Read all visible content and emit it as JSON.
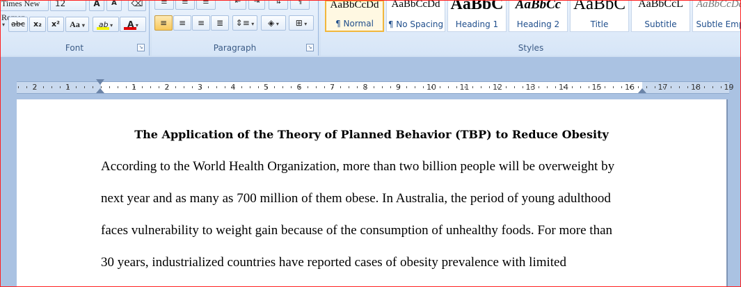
{
  "font_group": {
    "font_name": "Times New Roman",
    "font_size": "12",
    "label": "Font",
    "buttons": {
      "strikethrough": "abc",
      "subscript": "x₂",
      "superscript": "x²",
      "change_case": "Aa",
      "grow": "A",
      "shrink": "A",
      "font_color": "A",
      "highlight": "ab"
    }
  },
  "paragraph_group": {
    "label": "Paragraph"
  },
  "styles_group": {
    "label": "Styles",
    "items": [
      {
        "preview": "AaBbCcDd",
        "name": "¶ Normal"
      },
      {
        "preview": "AaBbCcDd",
        "name": "¶ No Spacing"
      },
      {
        "preview": "AaBbC",
        "name": "Heading 1"
      },
      {
        "preview": "AaBbCc",
        "name": "Heading 2"
      },
      {
        "preview": "AaBbC",
        "name": "Title"
      },
      {
        "preview": "AaBbCcL",
        "name": "Subtitle"
      },
      {
        "preview": "AaBbCcDd",
        "name": "Subtle Emp"
      }
    ]
  },
  "ruler": {
    "numbers": [
      "2",
      "1",
      "1",
      "2",
      "3",
      "4",
      "5",
      "6",
      "7",
      "8",
      "9",
      "10",
      "11",
      "12",
      "13",
      "14",
      "15",
      "16",
      "17",
      "18",
      "19"
    ]
  },
  "document": {
    "title": "The Application  of the Theory of Planned Behavior (TBP) to Reduce Obesity",
    "lines": [
      "According to the World Health Organization, more than two billion people will be overweight by",
      "next year and as many  as 700 million of them obese. In Australia, the period of young adulthood",
      "faces vulnerability to weight gain because of the consumption of unhealthy foods. For more than",
      "30 years, industrialized countries have reported cases of obesity prevalence with limited"
    ]
  },
  "colors": {
    "ribbon_bg": "#d6e5f7",
    "accent_border": "#ff2020",
    "font_color_bar": "#e00000",
    "highlight_bar": "#f4f40a"
  }
}
